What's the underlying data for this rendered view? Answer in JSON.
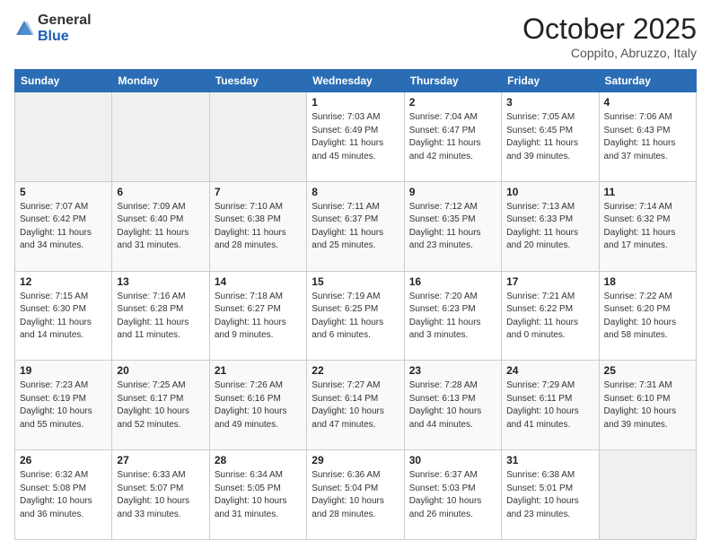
{
  "header": {
    "logo_general": "General",
    "logo_blue": "Blue",
    "month_title": "October 2025",
    "subtitle": "Coppito, Abruzzo, Italy"
  },
  "days_of_week": [
    "Sunday",
    "Monday",
    "Tuesday",
    "Wednesday",
    "Thursday",
    "Friday",
    "Saturday"
  ],
  "weeks": [
    [
      {
        "day": "",
        "info": ""
      },
      {
        "day": "",
        "info": ""
      },
      {
        "day": "",
        "info": ""
      },
      {
        "day": "1",
        "info": "Sunrise: 7:03 AM\nSunset: 6:49 PM\nDaylight: 11 hours\nand 45 minutes."
      },
      {
        "day": "2",
        "info": "Sunrise: 7:04 AM\nSunset: 6:47 PM\nDaylight: 11 hours\nand 42 minutes."
      },
      {
        "day": "3",
        "info": "Sunrise: 7:05 AM\nSunset: 6:45 PM\nDaylight: 11 hours\nand 39 minutes."
      },
      {
        "day": "4",
        "info": "Sunrise: 7:06 AM\nSunset: 6:43 PM\nDaylight: 11 hours\nand 37 minutes."
      }
    ],
    [
      {
        "day": "5",
        "info": "Sunrise: 7:07 AM\nSunset: 6:42 PM\nDaylight: 11 hours\nand 34 minutes."
      },
      {
        "day": "6",
        "info": "Sunrise: 7:09 AM\nSunset: 6:40 PM\nDaylight: 11 hours\nand 31 minutes."
      },
      {
        "day": "7",
        "info": "Sunrise: 7:10 AM\nSunset: 6:38 PM\nDaylight: 11 hours\nand 28 minutes."
      },
      {
        "day": "8",
        "info": "Sunrise: 7:11 AM\nSunset: 6:37 PM\nDaylight: 11 hours\nand 25 minutes."
      },
      {
        "day": "9",
        "info": "Sunrise: 7:12 AM\nSunset: 6:35 PM\nDaylight: 11 hours\nand 23 minutes."
      },
      {
        "day": "10",
        "info": "Sunrise: 7:13 AM\nSunset: 6:33 PM\nDaylight: 11 hours\nand 20 minutes."
      },
      {
        "day": "11",
        "info": "Sunrise: 7:14 AM\nSunset: 6:32 PM\nDaylight: 11 hours\nand 17 minutes."
      }
    ],
    [
      {
        "day": "12",
        "info": "Sunrise: 7:15 AM\nSunset: 6:30 PM\nDaylight: 11 hours\nand 14 minutes."
      },
      {
        "day": "13",
        "info": "Sunrise: 7:16 AM\nSunset: 6:28 PM\nDaylight: 11 hours\nand 11 minutes."
      },
      {
        "day": "14",
        "info": "Sunrise: 7:18 AM\nSunset: 6:27 PM\nDaylight: 11 hours\nand 9 minutes."
      },
      {
        "day": "15",
        "info": "Sunrise: 7:19 AM\nSunset: 6:25 PM\nDaylight: 11 hours\nand 6 minutes."
      },
      {
        "day": "16",
        "info": "Sunrise: 7:20 AM\nSunset: 6:23 PM\nDaylight: 11 hours\nand 3 minutes."
      },
      {
        "day": "17",
        "info": "Sunrise: 7:21 AM\nSunset: 6:22 PM\nDaylight: 11 hours\nand 0 minutes."
      },
      {
        "day": "18",
        "info": "Sunrise: 7:22 AM\nSunset: 6:20 PM\nDaylight: 10 hours\nand 58 minutes."
      }
    ],
    [
      {
        "day": "19",
        "info": "Sunrise: 7:23 AM\nSunset: 6:19 PM\nDaylight: 10 hours\nand 55 minutes."
      },
      {
        "day": "20",
        "info": "Sunrise: 7:25 AM\nSunset: 6:17 PM\nDaylight: 10 hours\nand 52 minutes."
      },
      {
        "day": "21",
        "info": "Sunrise: 7:26 AM\nSunset: 6:16 PM\nDaylight: 10 hours\nand 49 minutes."
      },
      {
        "day": "22",
        "info": "Sunrise: 7:27 AM\nSunset: 6:14 PM\nDaylight: 10 hours\nand 47 minutes."
      },
      {
        "day": "23",
        "info": "Sunrise: 7:28 AM\nSunset: 6:13 PM\nDaylight: 10 hours\nand 44 minutes."
      },
      {
        "day": "24",
        "info": "Sunrise: 7:29 AM\nSunset: 6:11 PM\nDaylight: 10 hours\nand 41 minutes."
      },
      {
        "day": "25",
        "info": "Sunrise: 7:31 AM\nSunset: 6:10 PM\nDaylight: 10 hours\nand 39 minutes."
      }
    ],
    [
      {
        "day": "26",
        "info": "Sunrise: 6:32 AM\nSunset: 5:08 PM\nDaylight: 10 hours\nand 36 minutes."
      },
      {
        "day": "27",
        "info": "Sunrise: 6:33 AM\nSunset: 5:07 PM\nDaylight: 10 hours\nand 33 minutes."
      },
      {
        "day": "28",
        "info": "Sunrise: 6:34 AM\nSunset: 5:05 PM\nDaylight: 10 hours\nand 31 minutes."
      },
      {
        "day": "29",
        "info": "Sunrise: 6:36 AM\nSunset: 5:04 PM\nDaylight: 10 hours\nand 28 minutes."
      },
      {
        "day": "30",
        "info": "Sunrise: 6:37 AM\nSunset: 5:03 PM\nDaylight: 10 hours\nand 26 minutes."
      },
      {
        "day": "31",
        "info": "Sunrise: 6:38 AM\nSunset: 5:01 PM\nDaylight: 10 hours\nand 23 minutes."
      },
      {
        "day": "",
        "info": ""
      }
    ]
  ]
}
